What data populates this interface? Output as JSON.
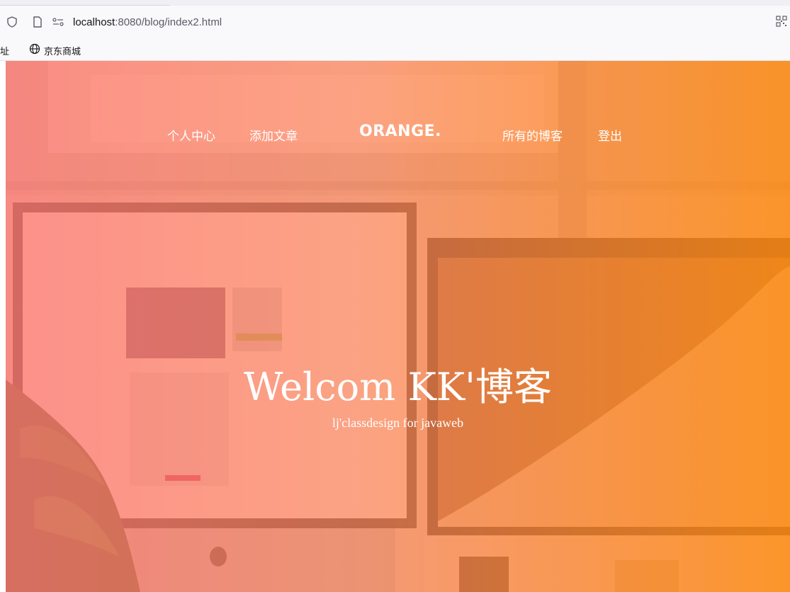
{
  "browser": {
    "url_host": "localhost",
    "url_rest": ":8080/blog/index2.html",
    "bookmarks": [
      "址",
      "京东商城"
    ]
  },
  "nav": {
    "left": [
      "个人中心",
      "添加文章"
    ],
    "brand": "ORANGE.",
    "right": [
      "所有的博客",
      "登出"
    ]
  },
  "hero": {
    "title": "Welcom KK'博客",
    "subtitle": "lj'classdesign for javaweb"
  },
  "colors": {
    "overlay_left": "#ff7870",
    "overlay_right": "#ff8c14"
  },
  "icons": [
    "shield-icon",
    "page-icon",
    "connection-icon",
    "qr-code-icon",
    "globe-icon"
  ]
}
